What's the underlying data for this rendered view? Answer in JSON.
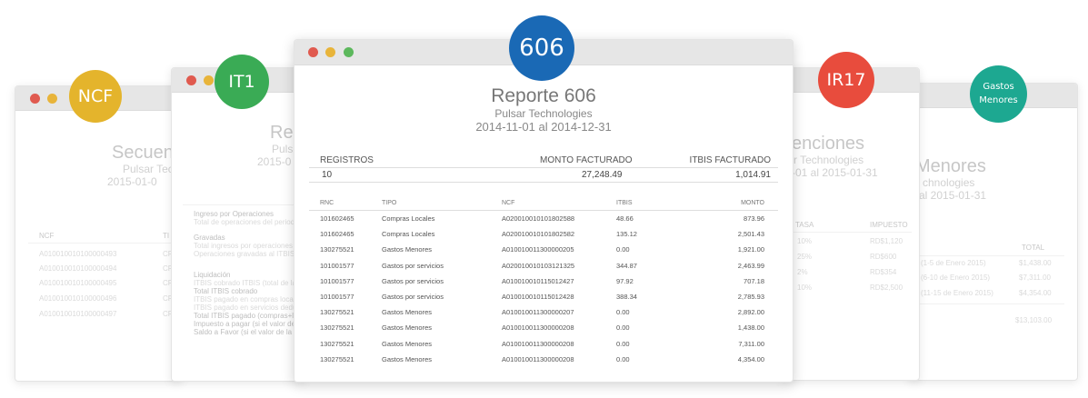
{
  "windows": {
    "ncf": {
      "badge": "NCF",
      "title": "Secuen",
      "company": "Pulsar Tecno",
      "range": "2015-01-0",
      "table": {
        "col1": "NCF",
        "col2": "TI"
      },
      "rows": [
        {
          "ncf": "A010010010100000493",
          "tipo": "CR"
        },
        {
          "ncf": "A010010010100000494",
          "tipo": "CR"
        },
        {
          "ncf": "A010010010100000495",
          "tipo": "CR"
        },
        {
          "ncf": "A010010010100000496",
          "tipo": "CR"
        },
        {
          "ncf": "A010010010100000497",
          "tipo": "CR"
        }
      ]
    },
    "it1": {
      "badge": "IT1",
      "title": "Reg",
      "company": "Puls",
      "range": "2015-0",
      "lines": [
        "Ingreso por Operaciones",
        "Total de operaciones del periodo",
        "Gravadas",
        "Total ingresos por operaciones gr",
        "Operaciones gravadas al ITBIS pen",
        "Liquidación",
        "ITBIS cobrado ITBIS (total de la ope",
        "Total ITBIS cobrado",
        "ITBIS pagado en compras locales",
        "ITBIS pagado en servicios deducibl",
        "Total ITBIS pagado (compras+loca",
        "Impuesto a pagar (si el valor de la",
        "Saldo a Favor (si el valor de la dife"
      ]
    },
    "r606": {
      "badge": "606",
      "title": "Reporte 606",
      "company": "Pulsar Technologies",
      "range": "2014-11-01 al 2014-12-31",
      "summary": {
        "registros_label": "REGISTROS",
        "registros_value": "10",
        "monto_label": "MONTO FACTURADO",
        "monto_value": "27,248.49",
        "itbis_label": "ITBIS FACTURADO",
        "itbis_value": "1,014.91"
      },
      "columns": [
        "RNC",
        "TIPO",
        "NCF",
        "ITBIS",
        "MONTO"
      ],
      "rows": [
        {
          "rnc": "101602465",
          "tipo": "Compras Locales",
          "ncf": "A020010010101802588",
          "itbis": "48.66",
          "monto": "873.96"
        },
        {
          "rnc": "101602465",
          "tipo": "Compras Locales",
          "ncf": "A020010010101802582",
          "itbis": "135.12",
          "monto": "2,501.43"
        },
        {
          "rnc": "130275521",
          "tipo": "Gastos Menores",
          "ncf": "A010010011300000205",
          "itbis": "0.00",
          "monto": "1,921.00"
        },
        {
          "rnc": "101001577",
          "tipo": "Gastos por servicios",
          "ncf": "A020010010103121325",
          "itbis": "344.87",
          "monto": "2,463.99"
        },
        {
          "rnc": "101001577",
          "tipo": "Gastos por servicios",
          "ncf": "A010010010115012427",
          "itbis": "97.92",
          "monto": "707.18"
        },
        {
          "rnc": "101001577",
          "tipo": "Gastos por servicios",
          "ncf": "A010010010115012428",
          "itbis": "388.34",
          "monto": "2,785.93"
        },
        {
          "rnc": "130275521",
          "tipo": "Gastos Menores",
          "ncf": "A010010011300000207",
          "itbis": "0.00",
          "monto": "2,892.00"
        },
        {
          "rnc": "130275521",
          "tipo": "Gastos Menores",
          "ncf": "A010010011300000208",
          "itbis": "0.00",
          "monto": "1,438.00"
        },
        {
          "rnc": "130275521",
          "tipo": "Gastos Menores",
          "ncf": "A010010011300000208",
          "itbis": "0.00",
          "monto": "7,311.00"
        },
        {
          "rnc": "130275521",
          "tipo": "Gastos Menores",
          "ncf": "A010010011300000208",
          "itbis": "0.00",
          "monto": "4,354.00"
        }
      ]
    },
    "ir17": {
      "badge": "IR17",
      "title": "enciones",
      "company": "r Technologies",
      "range": "-01 al 2015-01-31",
      "columns": [
        "TASA",
        "IMPUESTO"
      ],
      "rows": [
        {
          "tasa": "10%",
          "impuesto": "RD$1,120"
        },
        {
          "tasa": "25%",
          "impuesto": "RD$600"
        },
        {
          "tasa": "2%",
          "impuesto": "RD$354"
        },
        {
          "tasa": "10%",
          "impuesto": "RD$2,500"
        }
      ]
    },
    "gastos": {
      "badge_line1": "Gastos",
      "badge_line2": "Menores",
      "title": "Menores",
      "company": "chnologies",
      "range": "al 2015-01-31",
      "total_label": "TOTAL",
      "rows": [
        {
          "label": "(1-5 de Enero 2015)",
          "total": "$1,438.00"
        },
        {
          "label": "(6-10 de Enero 2015)",
          "total": "$7,311.00"
        },
        {
          "label": "(11-15 de Enero 2015)",
          "total": "$4,354.00"
        }
      ],
      "grand_total": "$13,103.00"
    }
  },
  "colors": {
    "ncf_badge": "#e4b42c",
    "it1_badge": "#3aab55",
    "r606_badge": "#1a69b5",
    "ir17_badge": "#e84c3d",
    "gastos_badge": "#1da891",
    "dot_red": "#e05a4f",
    "dot_yellow": "#e8b43a",
    "dot_green": "#5cb85c"
  }
}
